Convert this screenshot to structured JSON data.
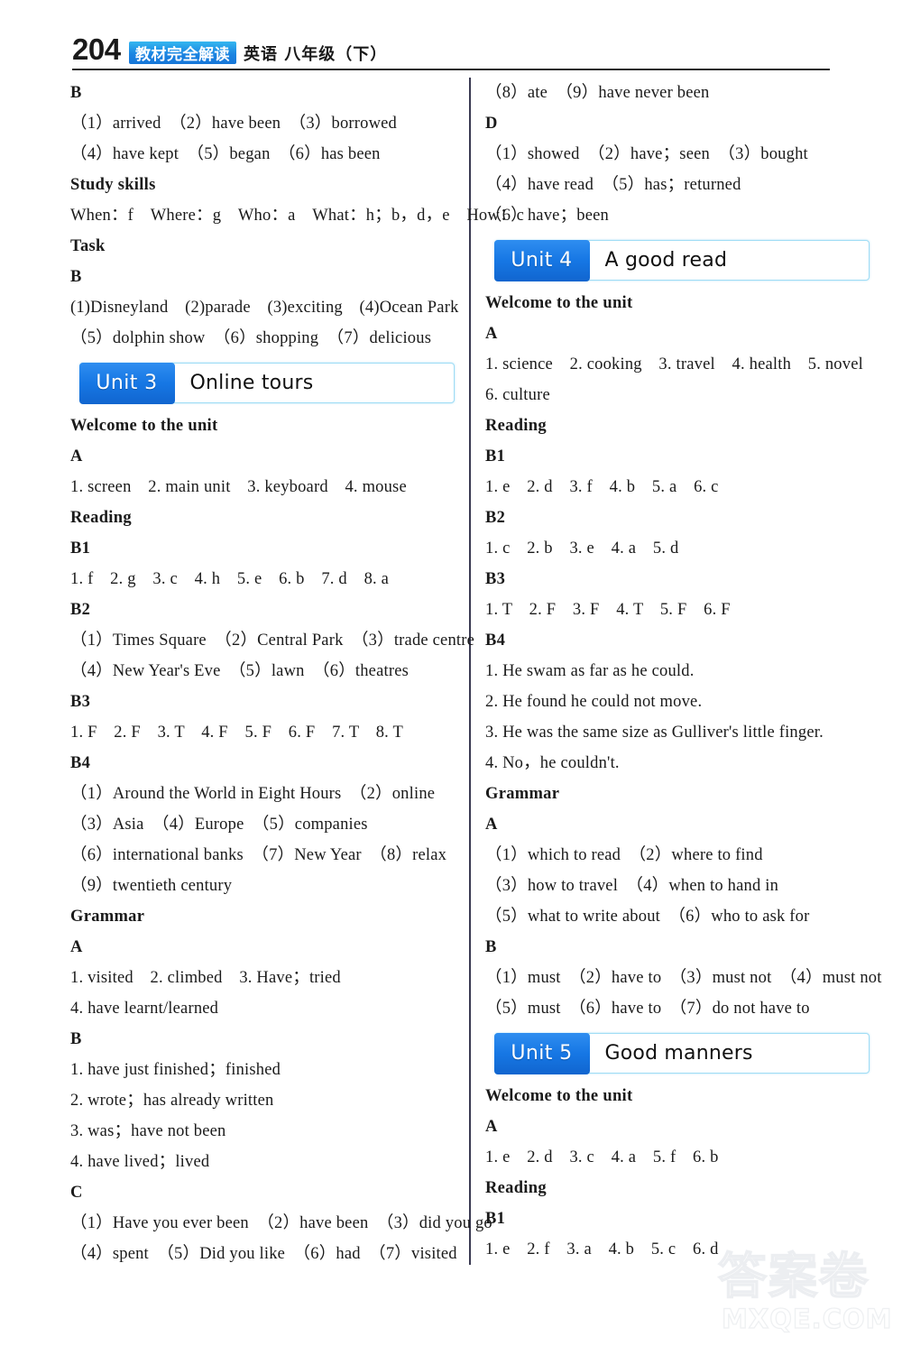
{
  "header": {
    "page_number": "204",
    "brand_badge": "教材完全解读",
    "subject": "英语 八年级（下）"
  },
  "watermark": {
    "cn_text": "答案卷",
    "url_text": "MXQE.COM"
  },
  "left_column": {
    "blocks": [
      {
        "type": "head",
        "text": "B"
      },
      {
        "type": "line",
        "text": "（1）arrived　（2）have been　（3）borrowed"
      },
      {
        "type": "line",
        "text": "（4）have kept　（5）began　（6）has been"
      },
      {
        "type": "head",
        "text": "Study skills"
      },
      {
        "type": "line",
        "text": "When：f　Where：g　Who：a　What：h；b，d，e　How：c"
      },
      {
        "type": "head",
        "text": "Task"
      },
      {
        "type": "head",
        "text": "B"
      },
      {
        "type": "line",
        "text": "(1)Disneyland　(2)parade　(3)exciting　(4)Ocean Park"
      },
      {
        "type": "line",
        "text": "（5）dolphin show　（6）shopping　（7）delicious"
      },
      {
        "type": "banner",
        "unit": "Unit 3",
        "title": "Online tours"
      },
      {
        "type": "head",
        "text": "Welcome to the unit"
      },
      {
        "type": "head",
        "text": "A"
      },
      {
        "type": "line",
        "text": "1. screen　2. main unit　3. keyboard　4. mouse"
      },
      {
        "type": "head",
        "text": "Reading"
      },
      {
        "type": "head",
        "text": "B1"
      },
      {
        "type": "line",
        "text": "1. f　2. g　3. c　4. h　5. e　6. b　7. d　8. a"
      },
      {
        "type": "head",
        "text": "B2"
      },
      {
        "type": "line",
        "text": "（1）Times Square　（2）Central Park　（3）trade centre"
      },
      {
        "type": "line",
        "text": "（4）New Year's Eve　（5）lawn　（6）theatres"
      },
      {
        "type": "head",
        "text": "B3"
      },
      {
        "type": "line",
        "text": "1. F　2. F　3. T　4. F　5. F　6. F　7. T　8. T"
      },
      {
        "type": "head",
        "text": "B4"
      },
      {
        "type": "line",
        "text": "（1）Around the World in Eight Hours　（2）online"
      },
      {
        "type": "line",
        "text": "（3）Asia　（4）Europe　（5）companies"
      },
      {
        "type": "line",
        "text": "（6）international banks　（7）New Year　（8）relax"
      },
      {
        "type": "line",
        "text": "（9）twentieth century"
      },
      {
        "type": "head",
        "text": "Grammar"
      },
      {
        "type": "head",
        "text": "A"
      },
      {
        "type": "line",
        "text": "1. visited　2. climbed　3. Have；tried"
      },
      {
        "type": "line",
        "text": "4. have learnt/learned"
      },
      {
        "type": "head",
        "text": "B"
      },
      {
        "type": "line",
        "text": "1. have just finished；finished"
      },
      {
        "type": "line",
        "text": "2. wrote；has already written"
      },
      {
        "type": "line",
        "text": "3. was；have not been"
      },
      {
        "type": "line",
        "text": "4. have lived；lived"
      },
      {
        "type": "head",
        "text": "C"
      },
      {
        "type": "line",
        "text": "（1）Have you ever been　（2）have been　（3）did you go"
      },
      {
        "type": "line",
        "text": "（4）spent　（5）Did you like　（6）had　（7）visited"
      }
    ]
  },
  "right_column": {
    "blocks": [
      {
        "type": "line",
        "text": "（8）ate　（9）have never been"
      },
      {
        "type": "head",
        "text": "D"
      },
      {
        "type": "line",
        "text": "（1）showed　（2）have；seen　（3）bought"
      },
      {
        "type": "line",
        "text": "（4）have read　（5）has；returned"
      },
      {
        "type": "line",
        "text": "（6）have；been"
      },
      {
        "type": "banner",
        "unit": "Unit 4",
        "title": "A good read"
      },
      {
        "type": "head",
        "text": "Welcome to the unit"
      },
      {
        "type": "head",
        "text": "A"
      },
      {
        "type": "line",
        "text": "1. science　2. cooking　3. travel　4. health　5. novel"
      },
      {
        "type": "line",
        "text": "6. culture"
      },
      {
        "type": "head",
        "text": "Reading"
      },
      {
        "type": "head",
        "text": "B1"
      },
      {
        "type": "line",
        "text": "1. e　2. d　3. f　4. b　5. a　6. c"
      },
      {
        "type": "head",
        "text": "B2"
      },
      {
        "type": "line",
        "text": "1. c　2. b　3. e　4. a　5. d"
      },
      {
        "type": "head",
        "text": "B3"
      },
      {
        "type": "line",
        "text": "1. T　2. F　3. F　4. T　5. F　6. F"
      },
      {
        "type": "head",
        "text": "B4"
      },
      {
        "type": "line",
        "text": "1. He swam as far as he could."
      },
      {
        "type": "line",
        "text": "2. He found he could not move."
      },
      {
        "type": "line",
        "text": "3. He was the same size as Gulliver's little finger."
      },
      {
        "type": "line",
        "text": "4. No，he couldn't."
      },
      {
        "type": "head",
        "text": "Grammar"
      },
      {
        "type": "head",
        "text": "A"
      },
      {
        "type": "line",
        "text": "（1）which to read　（2）where to find"
      },
      {
        "type": "line",
        "text": "（3）how to travel　（4）when to hand in"
      },
      {
        "type": "line",
        "text": "（5）what to write about　（6）who to ask for"
      },
      {
        "type": "head",
        "text": "B"
      },
      {
        "type": "line",
        "text": "（1）must　（2）have to　（3）must not　（4）must not"
      },
      {
        "type": "line",
        "text": "（5）must　（6）have to　（7）do not have to"
      },
      {
        "type": "banner",
        "unit": "Unit 5",
        "title": "Good manners"
      },
      {
        "type": "head",
        "text": "Welcome to the unit"
      },
      {
        "type": "head",
        "text": "A"
      },
      {
        "type": "line",
        "text": "1. e　2. d　3. c　4. a　5. f　6. b"
      },
      {
        "type": "head",
        "text": "Reading"
      },
      {
        "type": "head",
        "text": "B1"
      },
      {
        "type": "line",
        "text": "1. e　2. f　3. a　4. b　5. c　6. d"
      }
    ]
  }
}
